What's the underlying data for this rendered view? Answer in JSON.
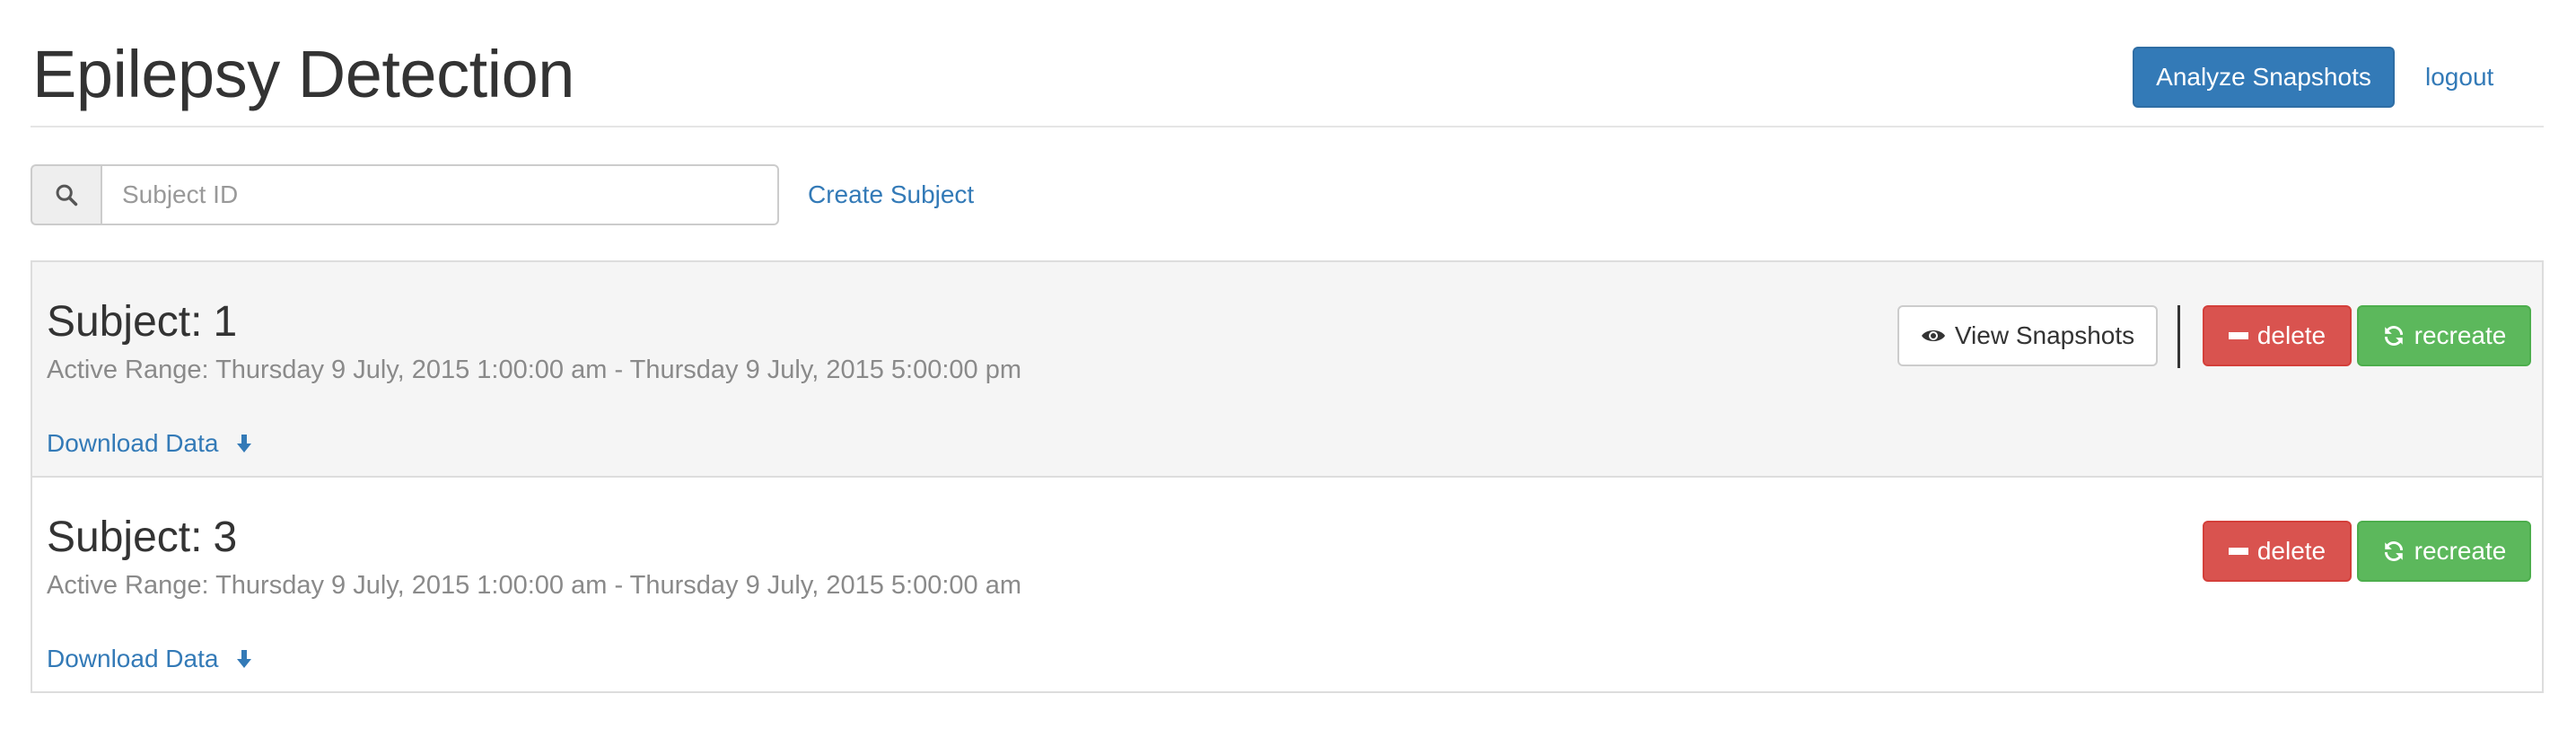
{
  "header": {
    "title": "Epilepsy Detection",
    "analyze_label": "Analyze Snapshots",
    "logout_label": "logout"
  },
  "search": {
    "placeholder": "Subject ID",
    "icon": "search-icon",
    "create_label": "Create Subject"
  },
  "subjects": [
    {
      "label": "Subject:",
      "id": "1",
      "range": "Active Range: Thursday 9 July, 2015 1:00:00 am - Thursday 9 July, 2015 5:00:00 pm",
      "download_label": "Download Data",
      "view_label": "View Snapshots",
      "delete_label": "delete",
      "recreate_label": "recreate"
    },
    {
      "label": "Subject:",
      "id": "3",
      "range": "Active Range: Thursday 9 July, 2015 1:00:00 am - Thursday 9 July, 2015 5:00:00 am",
      "download_label": "Download Data",
      "delete_label": "delete",
      "recreate_label": "recreate"
    }
  ],
  "colors": {
    "primary": "#337ab7",
    "danger": "#d9534f",
    "success": "#5cb85c",
    "muted_text": "#8a8a8a"
  }
}
